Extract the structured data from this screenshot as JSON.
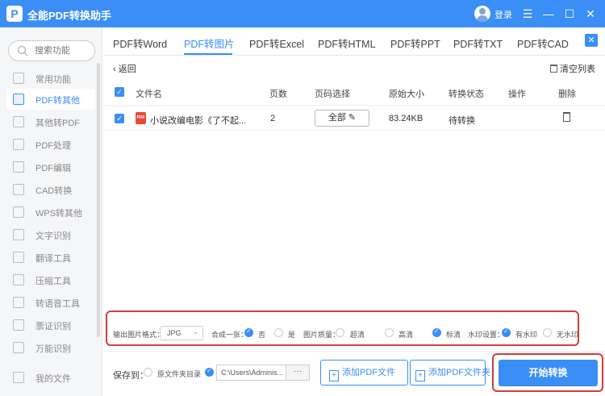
{
  "app": {
    "title": "全能PDF转换助手",
    "login_label": "登录",
    "logo_text": "P"
  },
  "window_buttons": {
    "menu": "☰",
    "minimize": "—",
    "maximize": "☐",
    "close": "✕"
  },
  "sidebar": {
    "search_placeholder": "搜索功能",
    "items": [
      {
        "label": "常用功能",
        "active": false
      },
      {
        "label": "PDF转其他",
        "active": true
      },
      {
        "label": "其他转PDF",
        "active": false
      },
      {
        "label": "PDF处理",
        "active": false
      },
      {
        "label": "PDF编辑",
        "active": false
      },
      {
        "label": "CAD转换",
        "active": false
      },
      {
        "label": "WPS转其他",
        "active": false
      },
      {
        "label": "文字识别",
        "active": false
      },
      {
        "label": "翻译工具",
        "active": false
      },
      {
        "label": "压缩工具",
        "active": false
      },
      {
        "label": "转语音工具",
        "active": false
      },
      {
        "label": "票证识别",
        "active": false
      },
      {
        "label": "万能识别",
        "active": false
      },
      {
        "label": "我的文件",
        "active": false
      }
    ]
  },
  "tabs": [
    {
      "label": "PDF转Word",
      "active": false
    },
    {
      "label": "PDF转图片",
      "active": true
    },
    {
      "label": "PDF转Excel",
      "active": false
    },
    {
      "label": "PDF转HTML",
      "active": false
    },
    {
      "label": "PDF转PPT",
      "active": false
    },
    {
      "label": "PDF转TXT",
      "active": false
    },
    {
      "label": "PDF转CAD",
      "active": false
    }
  ],
  "toolbar": {
    "back_label": "返回",
    "clear_label": "清空列表"
  },
  "table": {
    "headers": [
      "文件名",
      "页数",
      "页码选择",
      "原始大小",
      "转换状态",
      "操作",
      "删除"
    ],
    "rows": [
      {
        "file_name": "小说改编电影《了不起...",
        "pages": "2",
        "page_select": "全部",
        "size": "83.24KB",
        "status": "待转换",
        "checked": true
      }
    ]
  },
  "options": {
    "format_label": "输出图片格式：",
    "format_value": "JPG",
    "merge_label": "合成一张：",
    "merge_yes": "否",
    "merge_no": "是",
    "quality_label": "图片质量：",
    "quality_options": [
      "超清",
      "高清",
      "标清"
    ],
    "quality_selected": "标清",
    "watermark_label": "水印设置：",
    "watermark_options": [
      "有水印",
      "无水印"
    ],
    "watermark_selected": "有水印"
  },
  "output": {
    "save_label": "保存到：",
    "source_dir_label": "原文件夹目录",
    "path_value": "C:\\Users\\Adminis...",
    "browse_label": "···",
    "add_file_label": "添加PDF文件",
    "add_folder_label": "添加PDF文件夹",
    "start_label": "开始转换"
  },
  "colors": {
    "accent": "#3a8ef6",
    "highlight_border": "#d9393a",
    "pdf_badge": "#e84a3a"
  }
}
